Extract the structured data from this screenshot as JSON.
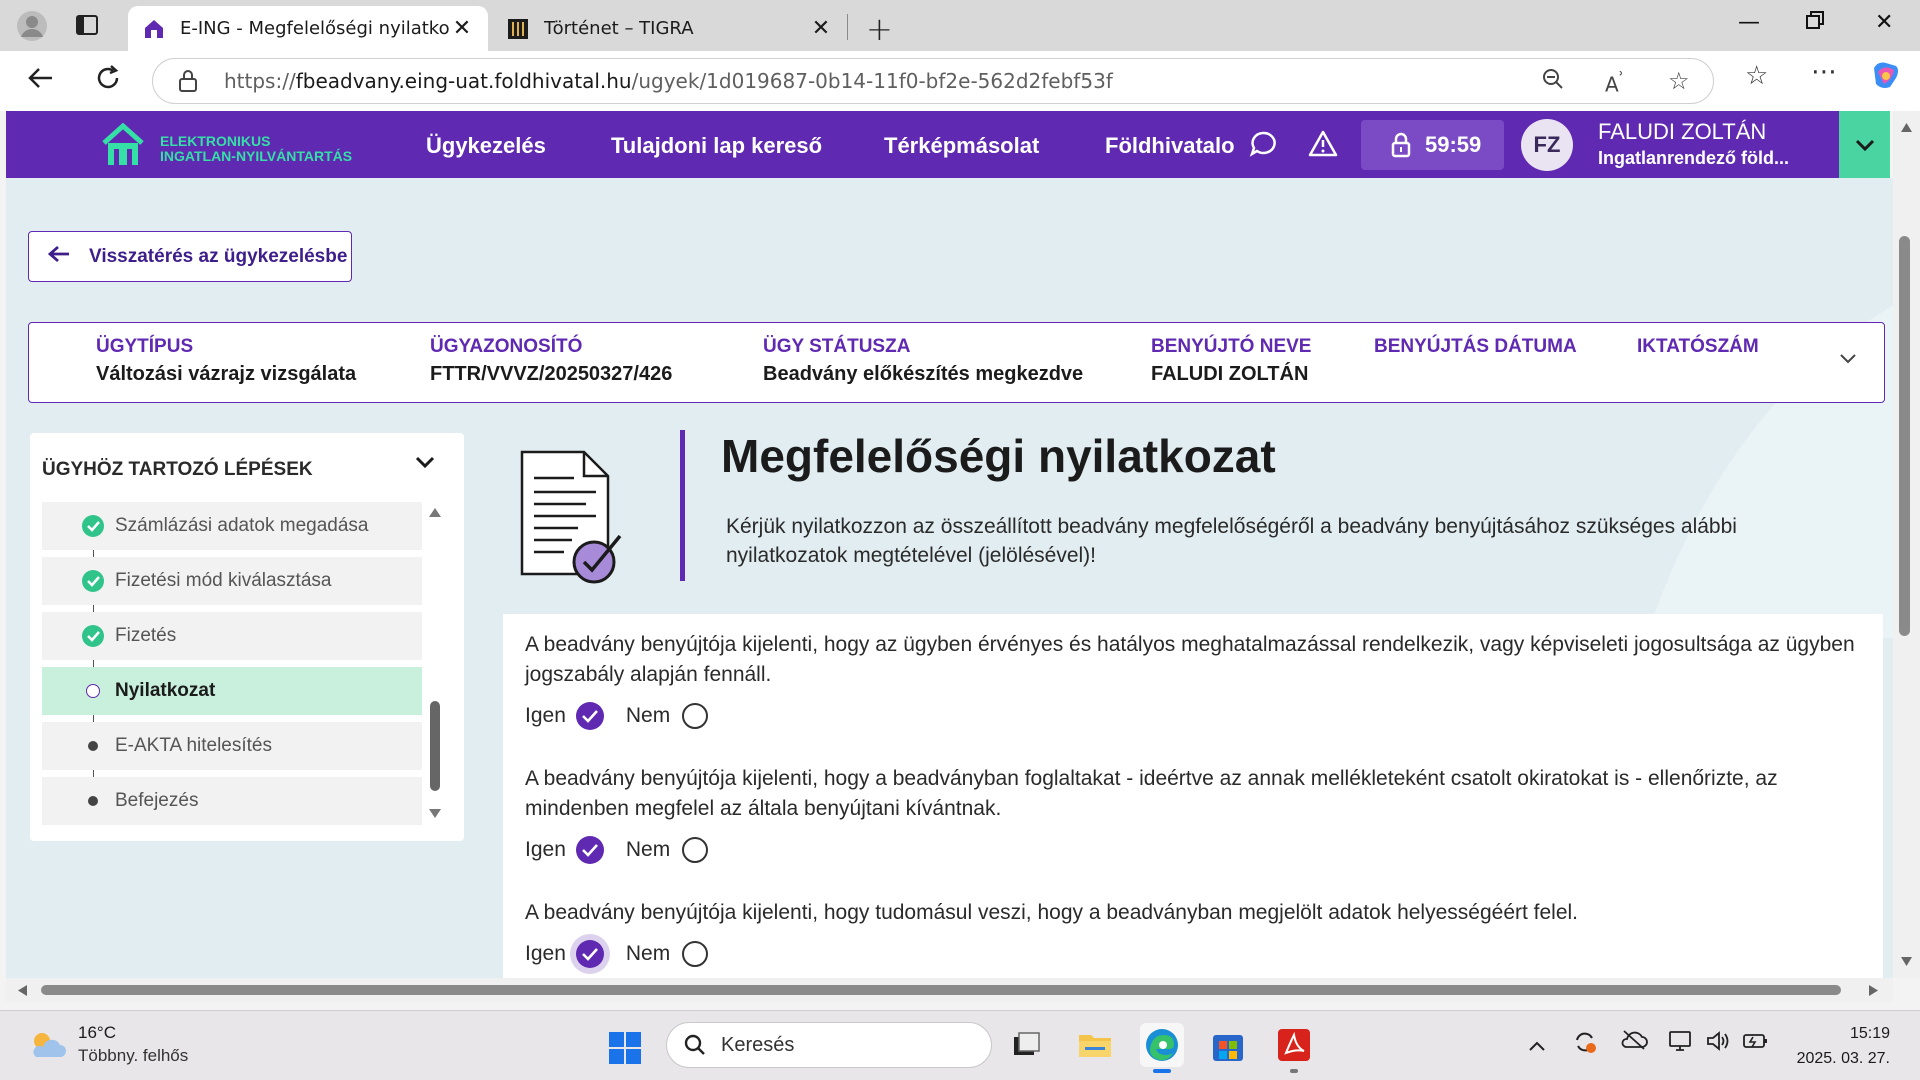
{
  "browser": {
    "tabs": [
      {
        "title": "E-ING - Megfelelőségi nyilatkozat",
        "active": true
      },
      {
        "title": "Történet – TIGRA",
        "active": false
      }
    ],
    "url_prefix": "https://",
    "url_host": "fbeadvany.eing-uat.foldhivatal.hu",
    "url_path": "/ugyek/1d019687-0b14-11f0-bf2e-562d2febf53f"
  },
  "app": {
    "logo_line1": "ELEKTRONIKUS",
    "logo_line2": "INGATLAN-NYILVÁNTARTÁS",
    "menu": [
      "Ügykezelés",
      "Tulajdoni lap kereső",
      "Térképmásolat",
      "Földhivatalo"
    ],
    "timer": "59:59",
    "user_initials": "FZ",
    "user_name": "FALUDI ZOLTÁN",
    "user_role": "Ingatlanrendező föld..."
  },
  "back_button": "Visszatérés az ügykezelésbe",
  "case_info": [
    {
      "label": "ÜGYTÍPUS",
      "value": "Változási vázrajz vizsgálata"
    },
    {
      "label": "ÜGYAZONOSÍTÓ",
      "value": "FTTR/VVVZ/20250327/426"
    },
    {
      "label": "ÜGY STÁTUSZA",
      "value": "Beadvány előkészítés megkezdve"
    },
    {
      "label": "BENYÚJTÓ NEVE",
      "value": "FALUDI ZOLTÁN"
    },
    {
      "label": "BENYÚJTÁS DÁTUMA",
      "value": ""
    },
    {
      "label": "IKTATÓSZÁM",
      "value": ""
    }
  ],
  "steps": {
    "heading": "ÜGYHÖZ TARTOZÓ LÉPÉSEK",
    "items": [
      {
        "label": "Számlázási adatok megadása",
        "state": "done"
      },
      {
        "label": "Fizetési mód kiválasztása",
        "state": "done"
      },
      {
        "label": "Fizetés",
        "state": "done"
      },
      {
        "label": "Nyilatkozat",
        "state": "current"
      },
      {
        "label": "E-AKTA hitelesítés",
        "state": "pending"
      },
      {
        "label": "Befejezés",
        "state": "pending"
      }
    ]
  },
  "hero": {
    "title": "Megfelelőségi nyilatkozat",
    "description": "Kérjük nyilatkozzon az összeállított beadvány megfelelőségéről a beadvány benyújtásához szükséges alábbi nyilatkozatok megtételével (jelölésével)!"
  },
  "declarations": {
    "yes_label": "Igen",
    "no_label": "Nem",
    "items": [
      {
        "text": "A beadvány benyújtója kijelenti, hogy az ügyben érvényes és hatályos meghatalmazással rendelkezik, vagy képviseleti jogosultsága az ügyben jogszabály alapján fennáll.",
        "selected": "Igen"
      },
      {
        "text": "A beadvány benyújtója kijelenti, hogy a beadványban foglaltakat - ideértve az annak mellékleteként csatolt okiratokat is - ellenőrizte, az mindenben megfelel az általa benyújtani kívántnak.",
        "selected": "Igen"
      },
      {
        "text": "A beadvány benyújtója kijelenti, hogy tudomásul veszi, hogy a beadványban megjelölt adatok helyességéért felel.",
        "selected": "Igen"
      }
    ]
  },
  "taskbar": {
    "temperature": "16°C",
    "weather": "Többny. felhős",
    "search_placeholder": "Keresés",
    "time": "15:19",
    "date": "2025. 03. 27."
  },
  "colors": {
    "brand_purple": "#5f29b1",
    "brand_green": "#35e0a6",
    "page_bg": "#e1edf1",
    "active_step_bg": "#c8f0dd"
  }
}
